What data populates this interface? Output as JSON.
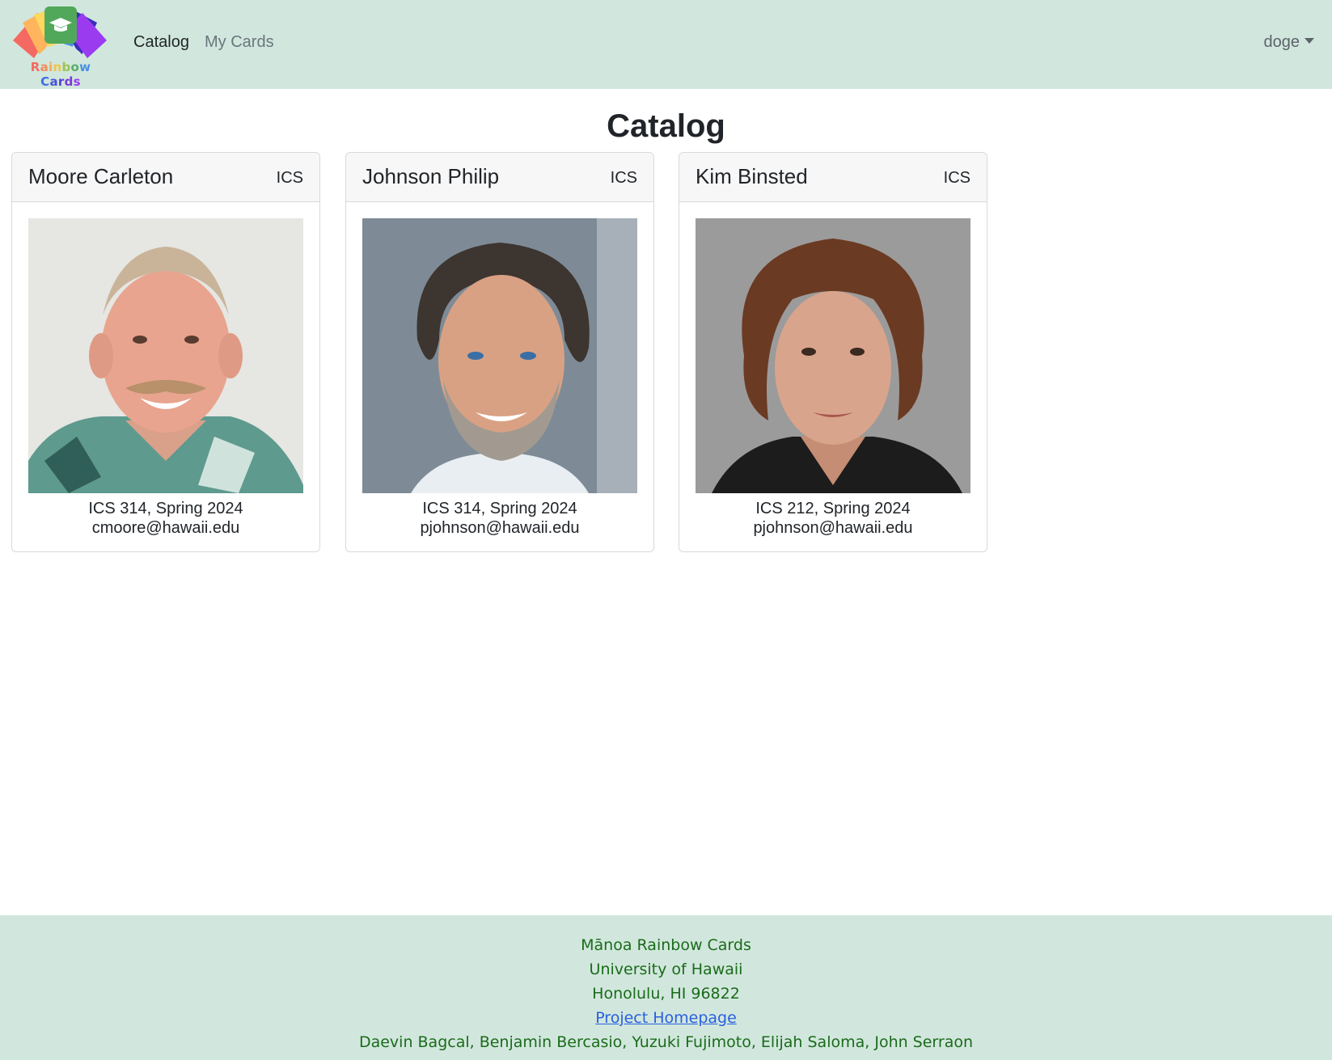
{
  "navbar": {
    "brand_text": "Rainbow Cards",
    "links": [
      {
        "label": "Catalog"
      },
      {
        "label": "My Cards"
      }
    ],
    "user_label": "doge"
  },
  "main": {
    "title": "Catalog",
    "cards": [
      {
        "name": "Moore Carleton",
        "department": "ICS",
        "course": "ICS 314, Spring 2024",
        "email": "cmoore@hawaii.edu"
      },
      {
        "name": "Johnson Philip",
        "department": "ICS",
        "course": "ICS 314, Spring 2024",
        "email": "pjohnson@hawaii.edu"
      },
      {
        "name": "Kim Binsted",
        "department": "ICS",
        "course": "ICS 212, Spring 2024",
        "email": "pjohnson@hawaii.edu"
      }
    ]
  },
  "footer": {
    "line1": "Mānoa Rainbow Cards",
    "line2": "University of Hawaii",
    "line3": "Honolulu, HI 96822",
    "homepage_link": "Project Homepage",
    "authors": "Daevin Bagcal, Benjamin Bercasio, Yuzuki Fujimoto, Elijah Saloma, John Serraon"
  },
  "colors": {
    "navbar_bg": "#d1e7dd",
    "footer_text": "#1a6b1a",
    "link": "#2a5fe0"
  }
}
